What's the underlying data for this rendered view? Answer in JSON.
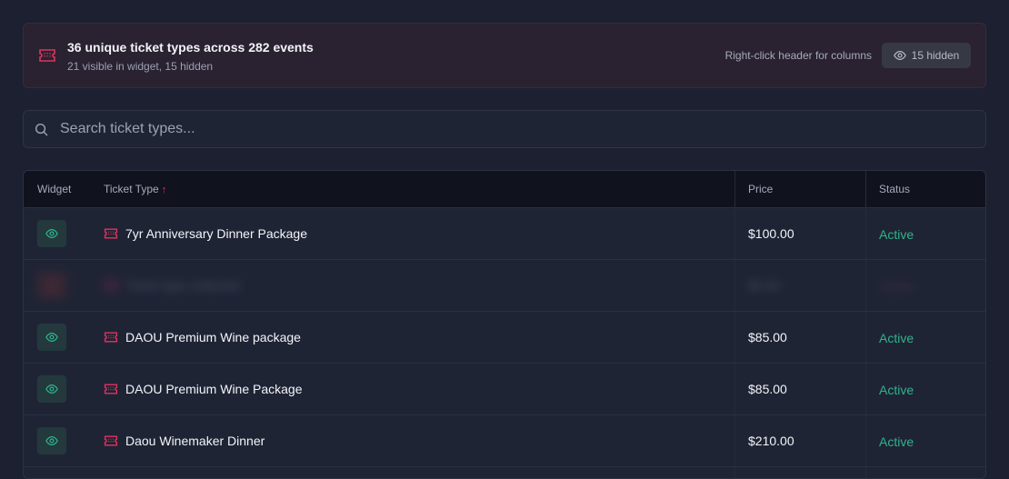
{
  "banner": {
    "title": "36 unique ticket types across 282 events",
    "subtitle": "21 visible in widget, 15 hidden",
    "hint": "Right-click header for columns",
    "hidden_button": "15 hidden"
  },
  "search": {
    "placeholder": "Search ticket types..."
  },
  "table": {
    "headers": {
      "widget": "Widget",
      "ticket_type": "Ticket Type",
      "sort": "↑",
      "price": "Price",
      "status": "Status"
    },
    "rows": [
      {
        "name": "7yr Anniversary Dinner Package",
        "price": "$100.00",
        "status": "Active"
      },
      {
        "name": "Ticket type redacted",
        "price": "$0.00",
        "status": "Active"
      },
      {
        "name": "DAOU Premium Wine package",
        "price": "$85.00",
        "status": "Active"
      },
      {
        "name": "DAOU Premium Wine Package",
        "price": "$85.00",
        "status": "Active"
      },
      {
        "name": "Daou Winemaker Dinner",
        "price": "$210.00",
        "status": "Active"
      }
    ]
  },
  "colors": {
    "accent": "#e0335f",
    "active": "#2fb38a"
  }
}
